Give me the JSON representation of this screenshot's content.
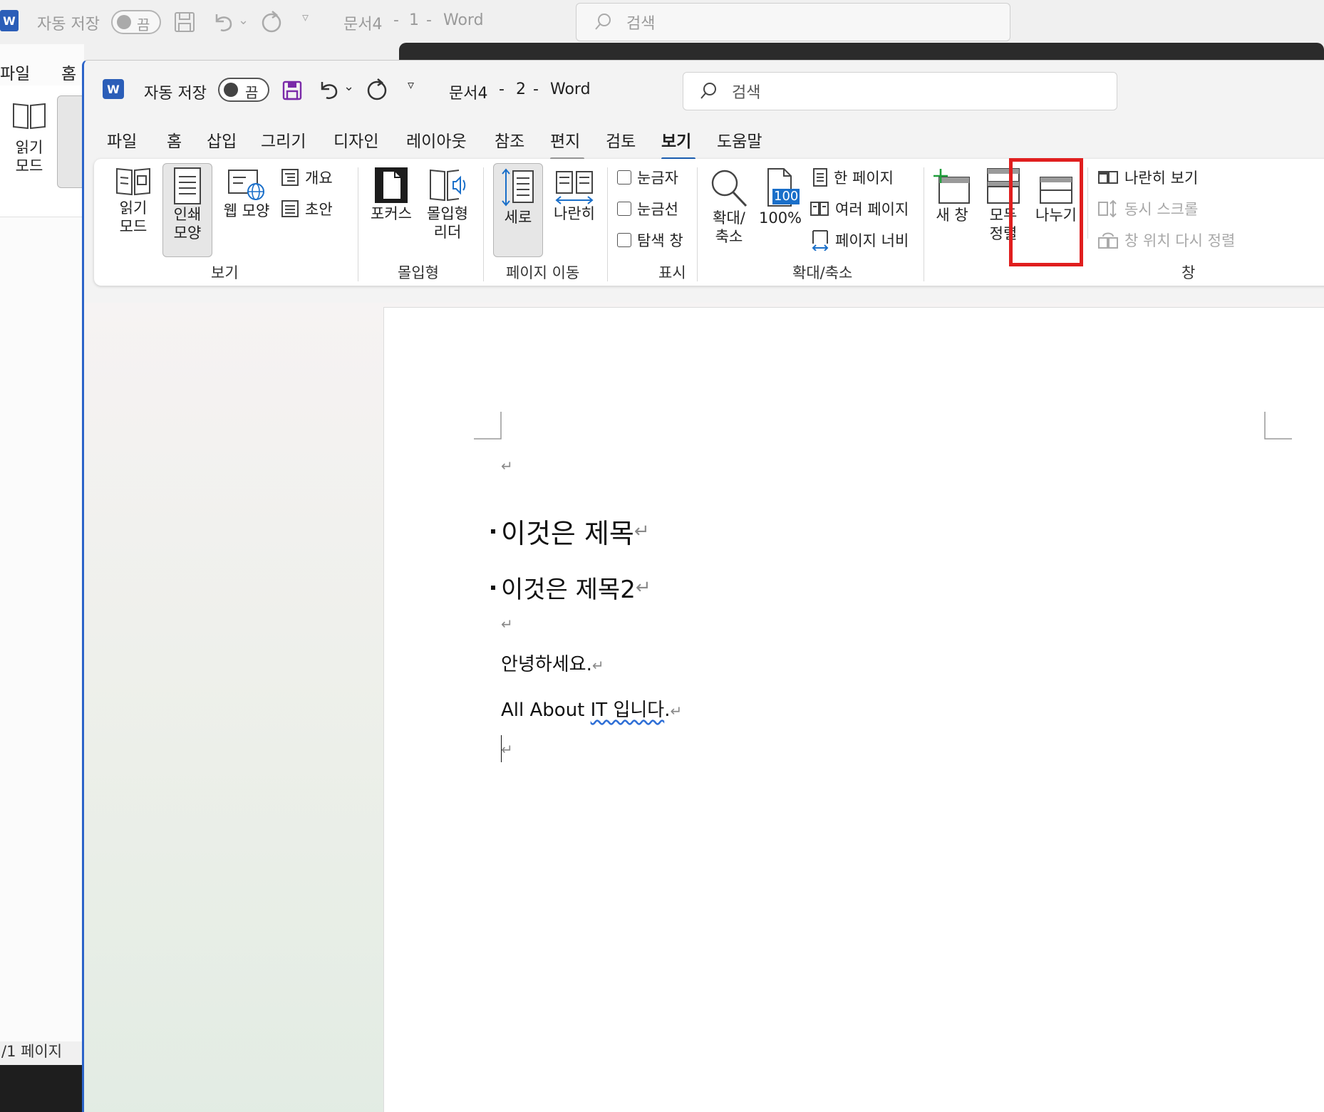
{
  "background_window": {
    "autosave_label": "자동 저장",
    "toggle_state": "끔",
    "doc_title": "문서4",
    "doc_number": "1",
    "app_name": "Word",
    "search_placeholder": "검색",
    "menu": [
      "파일",
      "홈"
    ],
    "ribbon_buttons": [
      "읽기 모드",
      "인쇄 모양"
    ],
    "status_page": "/1 페이지"
  },
  "titlebar": {
    "app_icon": "W",
    "autosave_label": "자동 저장",
    "toggle_state": "끔",
    "doc_title": "문서4",
    "doc_number": "2",
    "app_name": "Word",
    "search_placeholder": "검색"
  },
  "menu": {
    "items": [
      "파일",
      "홈",
      "삽입",
      "그리기",
      "디자인",
      "레이아웃",
      "참조",
      "편지",
      "검토",
      "보기",
      "도움말"
    ],
    "active": "보기",
    "colors": {
      "active_underline": "#1a5fb4",
      "mail_underline": "#9a9a9a"
    }
  },
  "ribbon": {
    "groups": {
      "view": {
        "label": "보기",
        "read_mode": "읽기 모드",
        "read_mode_l1": "읽기",
        "read_mode_l2": "모드",
        "print_layout_l1": "인쇄",
        "print_layout_l2": "모양",
        "web_layout": "웹 모양",
        "outline": "개요",
        "draft": "초안"
      },
      "immersive": {
        "label": "몰입형",
        "focus": "포커스",
        "reader_l1": "몰입형",
        "reader_l2": "리더"
      },
      "page_move": {
        "label": "페이지 이동",
        "vertical": "세로",
        "side_by_side": "나란히"
      },
      "show": {
        "label": "표시",
        "ruler": "눈금자",
        "gridlines": "눈금선",
        "nav_pane": "탐색 창"
      },
      "zoom": {
        "label": "확대/축소",
        "zoom_l1": "확대/",
        "zoom_l2": "축소",
        "hundred": "100%",
        "hundred_icon_text": "100",
        "one_page": "한 페이지",
        "multi_page": "여러 페이지",
        "page_width": "페이지 너비"
      },
      "window": {
        "label": "창",
        "new_window": "새 창",
        "arrange_l1": "모두",
        "arrange_l2": "정렬",
        "split": "나누기",
        "side_by_side": "나란히 보기",
        "sync_scroll": "동시 스크롤",
        "reset_position": "창 위치 다시 정렬"
      }
    },
    "highlight_color": "#e01e1e"
  },
  "document": {
    "empty_mark": "↵",
    "heading1": "이것은 제목",
    "heading2": "이것은 제목2",
    "line1": "안녕하세요.",
    "line2_a": "All About ",
    "line2_b": "IT 입니다",
    "line2_c": "."
  }
}
